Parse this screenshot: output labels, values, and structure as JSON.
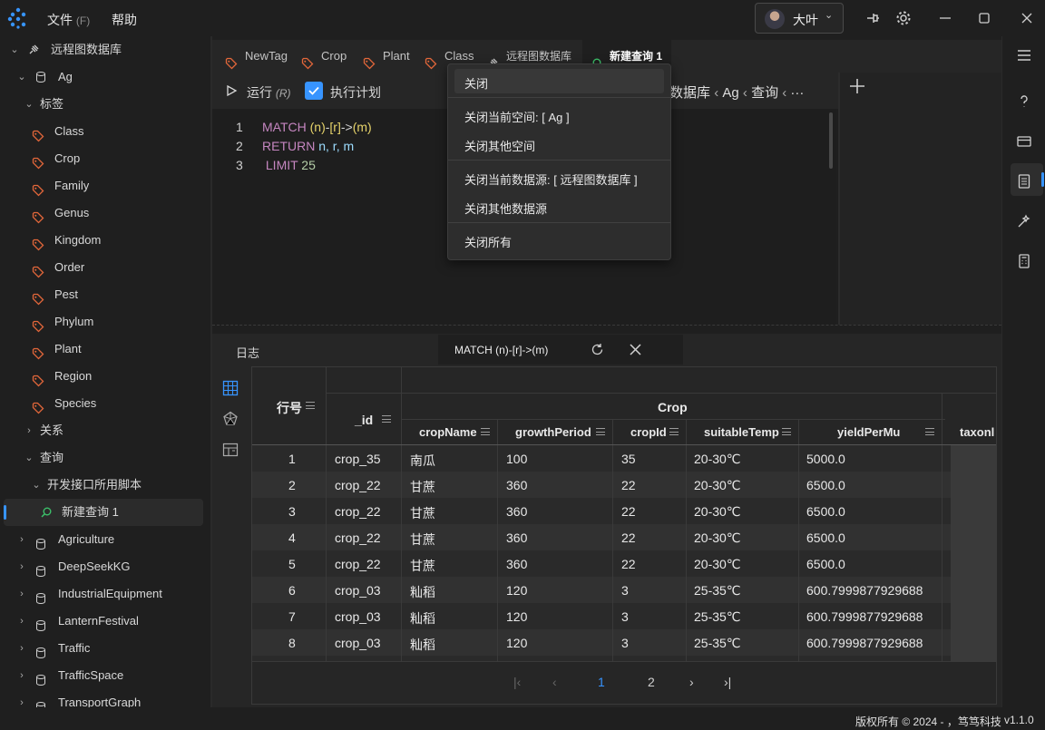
{
  "app": {
    "menu": [
      {
        "label": "文件",
        "hotkey": "(F)"
      },
      {
        "label": "帮助"
      }
    ],
    "user_name": "大叶",
    "accent": "#3794ff"
  },
  "sidebar": {
    "root": "远程图数据库",
    "space": "Ag",
    "tags_group": "标签",
    "tags": [
      "Class",
      "Crop",
      "Family",
      "Genus",
      "Kingdom",
      "Order",
      "Pest",
      "Phylum",
      "Plant",
      "Region",
      "Species"
    ],
    "relations_group": "关系",
    "queries_group": "查询",
    "query_folder": "开发接口所用脚本",
    "active_query": "新建查询 1",
    "other_spaces": [
      "Agriculture",
      "DeepSeekKG",
      "IndustrialEquipment",
      "LanternFestival",
      "Traffic",
      "TrafficSpace",
      "TransportGraph"
    ]
  },
  "tabs": [
    "NewTag",
    "Crop",
    "Plant",
    "Class",
    "远程图数据库",
    "新建查询 1"
  ],
  "toolbar": {
    "run_label": "运行",
    "run_hotkey": "(R)",
    "plan_label": "执行计划",
    "breadcrumb": [
      "数据库",
      "Ag",
      "查询"
    ],
    "more": "···"
  },
  "editor": {
    "line_numbers": [
      "1",
      "2",
      "3"
    ],
    "line1": {
      "kw": "MATCH",
      "rest": [
        " ",
        "(n)",
        "-",
        "[r]",
        "->",
        "(m)"
      ]
    },
    "line2": {
      "kw": "RETURN",
      "rest": " n, r, m"
    },
    "line3": {
      "kw": " LIMIT",
      "num": " 25"
    }
  },
  "context_menu": [
    "关闭",
    "关闭当前空间: [ Ag ]",
    "关闭其他空间",
    "关闭当前数据源: [ 远程图数据库 ]",
    "关闭其他数据源",
    "关闭所有"
  ],
  "results": {
    "log_tab": "日志",
    "query_tab": "MATCH (n)-[r]->(m)",
    "row_header": "行号",
    "id_header": "_id",
    "group_header": "Crop",
    "columns": [
      "cropName",
      "growthPeriod",
      "cropId",
      "suitableTemp",
      "yieldPerMu",
      "taxonl"
    ],
    "rows": [
      [
        "1",
        "crop_35",
        "南瓜",
        "100",
        "35",
        "20-30℃",
        "5000.0"
      ],
      [
        "2",
        "crop_22",
        "甘蔗",
        "360",
        "22",
        "20-30℃",
        "6500.0"
      ],
      [
        "3",
        "crop_22",
        "甘蔗",
        "360",
        "22",
        "20-30℃",
        "6500.0"
      ],
      [
        "4",
        "crop_22",
        "甘蔗",
        "360",
        "22",
        "20-30℃",
        "6500.0"
      ],
      [
        "5",
        "crop_22",
        "甘蔗",
        "360",
        "22",
        "20-30℃",
        "6500.0"
      ],
      [
        "6",
        "crop_03",
        "籼稻",
        "120",
        "3",
        "25-35℃",
        "600.7999877929688"
      ],
      [
        "7",
        "crop_03",
        "籼稻",
        "120",
        "3",
        "25-35℃",
        "600.7999877929688"
      ],
      [
        "8",
        "crop_03",
        "籼稻",
        "120",
        "3",
        "25-35℃",
        "600.7999877929688"
      ]
    ],
    "pager": {
      "pages": [
        "1",
        "2"
      ],
      "current": "1"
    }
  },
  "status": {
    "copyright": "版权所有 © 2024 - ，笃笃科技",
    "version": "v1.1.0"
  }
}
